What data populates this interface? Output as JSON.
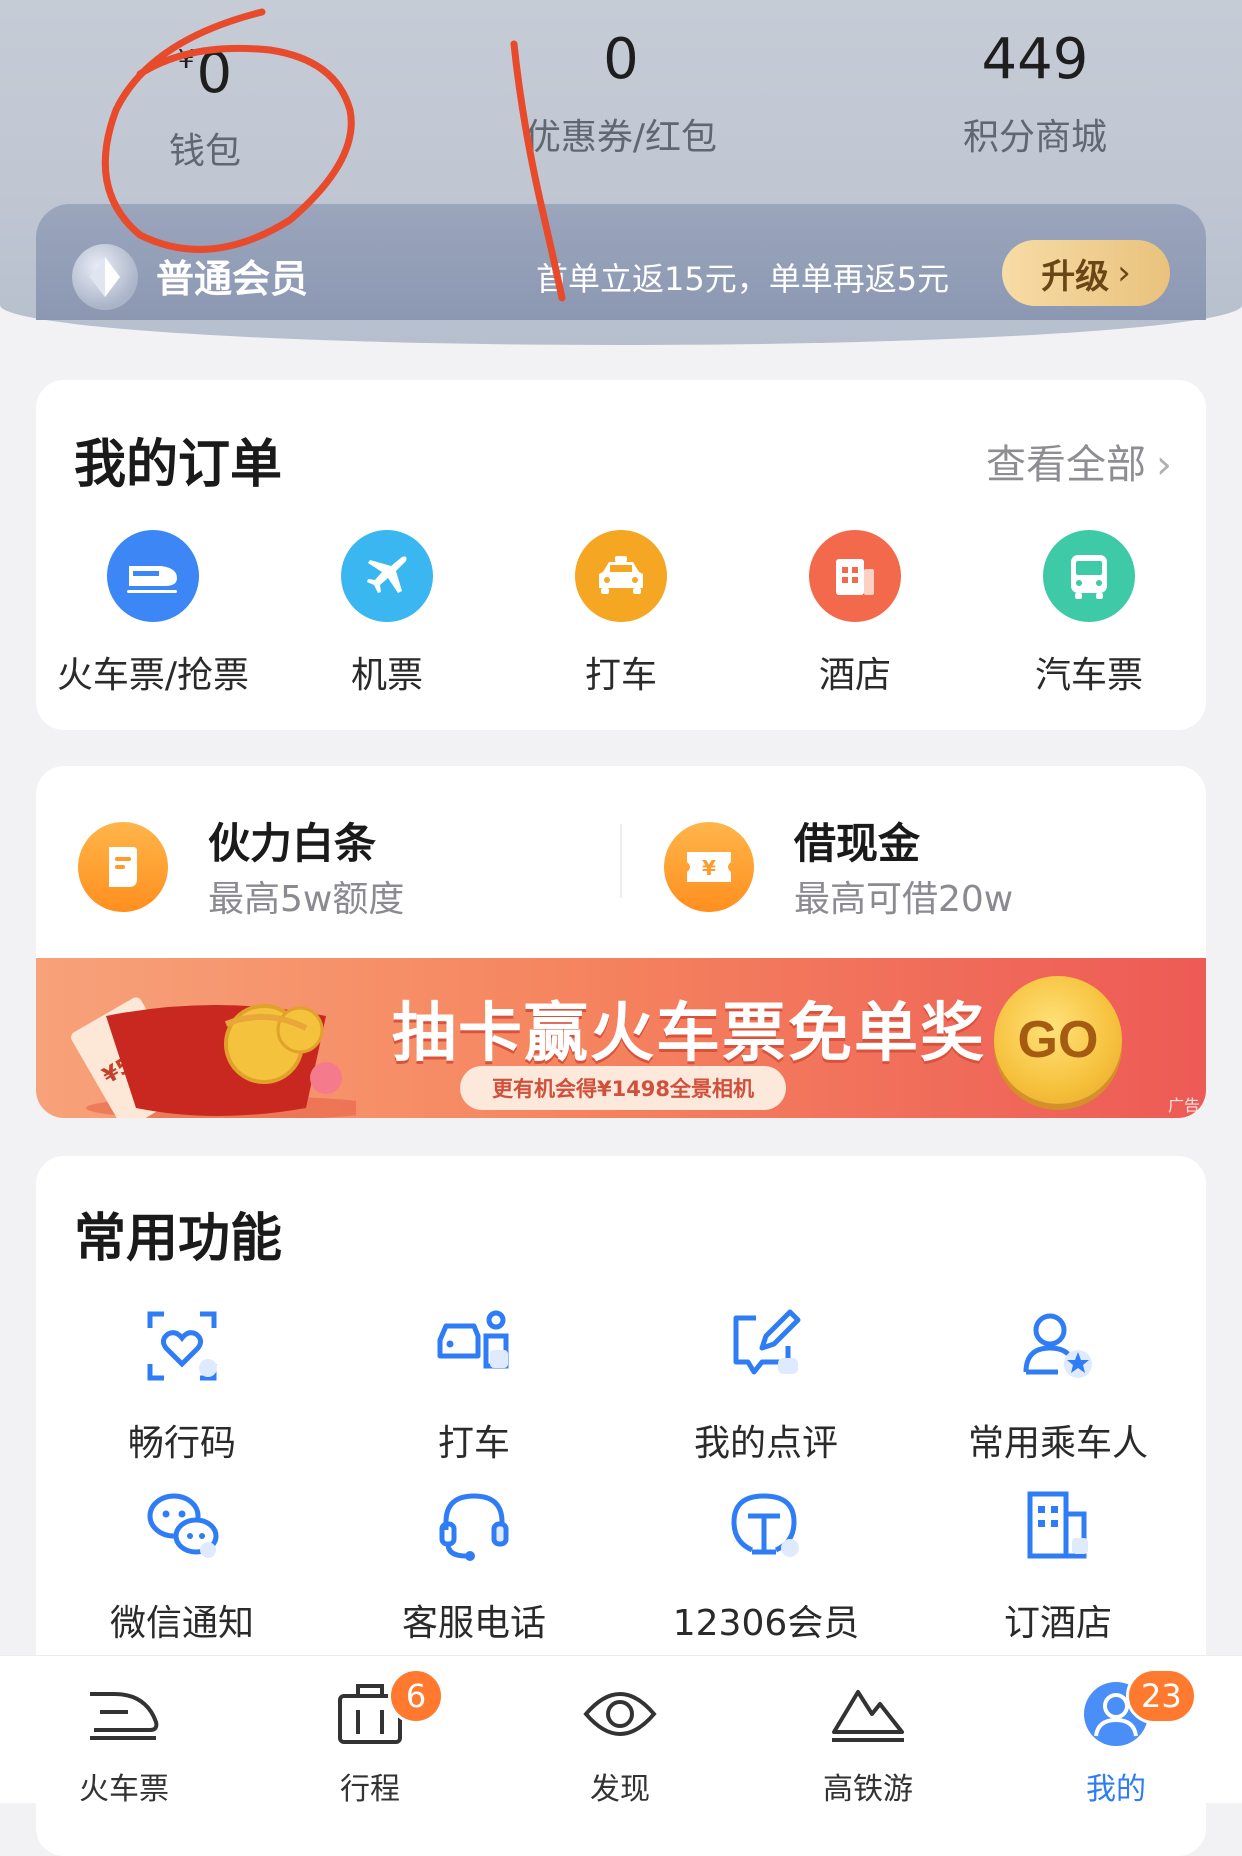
{
  "header": {
    "wallet": {
      "currency": "¥",
      "value": "0",
      "label": "钱包"
    },
    "coupons": {
      "value": "0",
      "label": "优惠券/红包"
    },
    "points": {
      "value": "449",
      "label": "积分商城"
    },
    "member": {
      "level": "普通会员",
      "promo": "首单立返15元，单单再返5元",
      "upgrade_label": "升级",
      "chevron": "›"
    }
  },
  "orders": {
    "title": "我的订单",
    "view_all": "查看全部",
    "chevron": "›",
    "items": [
      {
        "label": "火车票/抢票",
        "icon": "train-icon",
        "color": "#3d86f5"
      },
      {
        "label": "机票",
        "icon": "plane-icon",
        "color": "#3ab7f0"
      },
      {
        "label": "打车",
        "icon": "taxi-icon",
        "color": "#f5a623"
      },
      {
        "label": "酒店",
        "icon": "hotel-icon",
        "color": "#f26a4b"
      },
      {
        "label": "汽车票",
        "icon": "bus-icon",
        "color": "#3ec9a7"
      }
    ]
  },
  "finance": {
    "items": [
      {
        "title": "伙力白条",
        "subtitle": "最高5w额度",
        "icon": "credit-note-icon"
      },
      {
        "title": "借现金",
        "subtitle": "最高可借20w",
        "icon": "cash-ticket-icon"
      }
    ],
    "banner": {
      "title": "抽卡赢火车票免单奖",
      "subtitle": "更有机会得¥1498全景相机",
      "cta": "GO",
      "ticket_text": "¥500",
      "ad_tag": "广告"
    }
  },
  "features": {
    "title": "常用功能",
    "items": [
      {
        "label": "畅行码",
        "icon": "scan-heart-icon"
      },
      {
        "label": "打车",
        "icon": "taxi-service-icon"
      },
      {
        "label": "我的点评",
        "icon": "review-edit-icon"
      },
      {
        "label": "常用乘车人",
        "icon": "passenger-icon"
      },
      {
        "label": "微信通知",
        "icon": "wechat-icon"
      },
      {
        "label": "客服电话",
        "icon": "headset-icon"
      },
      {
        "label": "12306会员",
        "icon": "railway-logo-icon"
      },
      {
        "label": "订酒店",
        "icon": "hotel-building-icon"
      }
    ]
  },
  "tabbar": {
    "items": [
      {
        "label": "火车票",
        "icon": "train-tab-icon",
        "badge": ""
      },
      {
        "label": "行程",
        "icon": "itinerary-icon",
        "badge": "6"
      },
      {
        "label": "发现",
        "icon": "discover-icon",
        "badge": ""
      },
      {
        "label": "高铁游",
        "icon": "mountain-icon",
        "badge": ""
      },
      {
        "label": "我的",
        "icon": "profile-icon",
        "badge": "23"
      }
    ],
    "active_index": 4
  },
  "colors": {
    "accent": "#2f7df6",
    "badge": "#ff7a2e",
    "annotation": "#e84a2c"
  }
}
